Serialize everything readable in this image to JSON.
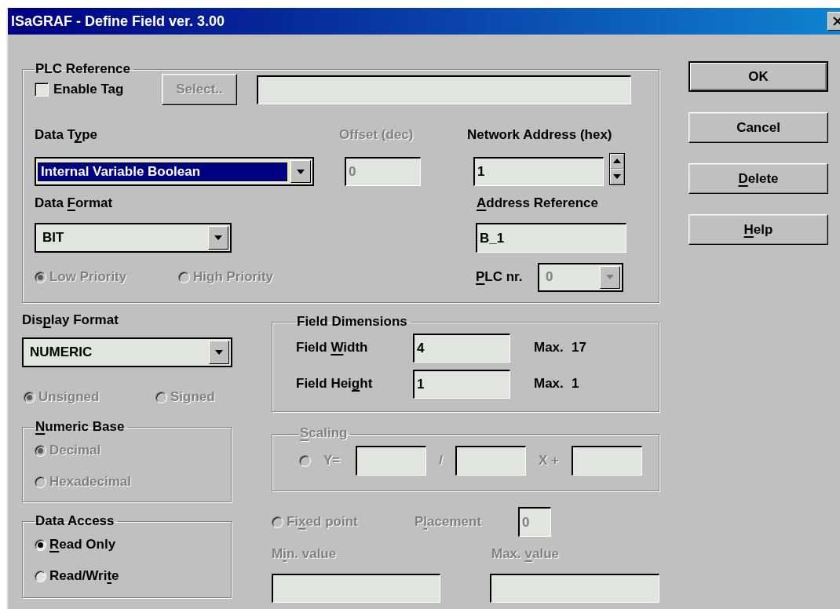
{
  "window": {
    "title": "ISaGRAF - Define Field ver. 3.00"
  },
  "plc_reference": {
    "title": "PLC Reference",
    "enable_tag": {
      "label": "Enable Tag",
      "checked": false
    },
    "select_button": {
      "label": "Select..",
      "disabled": true
    },
    "data_type": {
      "label": [
        {
          "text": "Data T",
          "underline": false
        },
        {
          "text": "y",
          "underline": true
        },
        {
          "text": "pe",
          "underline": false
        }
      ],
      "value": "Internal Variable Boolean",
      "focused": true
    },
    "offset": {
      "label": "Offset (dec)",
      "value": "0",
      "disabled": true
    },
    "network_address": {
      "label": "Network Address (hex)",
      "value": "1"
    },
    "data_format": {
      "label": [
        {
          "text": "Data ",
          "underline": false
        },
        {
          "text": "F",
          "underline": true
        },
        {
          "text": "ormat",
          "underline": false
        }
      ],
      "value": "BIT"
    },
    "address_reference": {
      "label": [
        {
          "text": "A",
          "underline": true
        },
        {
          "text": "ddress Reference",
          "underline": false
        }
      ],
      "value": "B_1"
    },
    "priority": [
      {
        "label": "Low Priority",
        "selected": true,
        "disabled": true
      },
      {
        "label": "High Priority",
        "selected": false,
        "disabled": true
      }
    ],
    "plc_nr": {
      "label": [
        {
          "text": "P",
          "underline": true
        },
        {
          "text": "LC nr.",
          "underline": false
        }
      ],
      "value": "0",
      "disabled": true
    }
  },
  "display_format": {
    "label": [
      {
        "text": "Dis",
        "underline": false
      },
      {
        "text": "p",
        "underline": true
      },
      {
        "text": "lay Format",
        "underline": false
      }
    ],
    "value": "NUMERIC"
  },
  "sign": [
    {
      "label": "Unsigned",
      "selected": true,
      "disabled": true
    },
    {
      "label": "Signed",
      "selected": false,
      "disabled": true
    }
  ],
  "numeric_base": {
    "title": [
      {
        "text": "N",
        "underline": true
      },
      {
        "text": "umeric Base",
        "underline": false
      }
    ],
    "options": [
      {
        "label": "Decimal",
        "selected": true,
        "disabled": true
      },
      {
        "label": "Hexadecimal",
        "selected": false,
        "disabled": true
      }
    ]
  },
  "data_access": {
    "title": "Data Access",
    "options": [
      {
        "label": [
          {
            "text": "R",
            "underline": true
          },
          {
            "text": "ead Only",
            "underline": false
          }
        ],
        "selected": true,
        "disabled": false
      },
      {
        "label": [
          {
            "text": "Read/Wri",
            "underline": false
          },
          {
            "text": "t",
            "underline": true
          },
          {
            "text": "e",
            "underline": false
          }
        ],
        "selected": false,
        "disabled": false
      }
    ]
  },
  "field_dimensions": {
    "title": "Field Dimensions",
    "rows": [
      {
        "label": [
          {
            "text": "Field ",
            "underline": false
          },
          {
            "text": "W",
            "underline": true
          },
          {
            "text": "idth",
            "underline": false
          }
        ],
        "value": "4",
        "max_label": "Max.",
        "max_value": "17"
      },
      {
        "label": [
          {
            "text": "Field Hei",
            "underline": false
          },
          {
            "text": "g",
            "underline": true
          },
          {
            "text": "ht",
            "underline": false
          }
        ],
        "value": "1",
        "max_label": "Max.",
        "max_value": "1"
      }
    ]
  },
  "scaling": {
    "title": [
      {
        "text": "S",
        "underline": true
      },
      {
        "text": "caling",
        "underline": false
      }
    ],
    "disabled": true,
    "selected": false,
    "y_label": "Y=",
    "divide": "/",
    "x_label": "X +"
  },
  "fixed_point": {
    "label": [
      {
        "text": "Fi",
        "underline": false
      },
      {
        "text": "x",
        "underline": true
      },
      {
        "text": "ed point",
        "underline": false
      }
    ],
    "selected": false,
    "disabled": true
  },
  "placement": {
    "label": [
      {
        "text": "P",
        "underline": false
      },
      {
        "text": "l",
        "underline": true
      },
      {
        "text": "acement",
        "underline": false
      }
    ],
    "value": "0",
    "disabled": true
  },
  "min_value": {
    "label": [
      {
        "text": "M",
        "underline": false
      },
      {
        "text": "i",
        "underline": true
      },
      {
        "text": "n. value",
        "underline": false
      }
    ],
    "disabled": true
  },
  "max_value": {
    "label": [
      {
        "text": "Max. ",
        "underline": false
      },
      {
        "text": "v",
        "underline": true
      },
      {
        "text": "alue",
        "underline": false
      }
    ],
    "disabled": true
  },
  "buttons": [
    {
      "label": "OK",
      "default": true
    },
    {
      "label": "Cancel",
      "default": false
    },
    {
      "label": [
        {
          "text": "D",
          "underline": true
        },
        {
          "text": "elete",
          "underline": false
        }
      ],
      "default": false
    },
    {
      "label": [
        {
          "text": "H",
          "underline": true
        },
        {
          "text": "elp",
          "underline": false
        }
      ],
      "default": false
    }
  ]
}
